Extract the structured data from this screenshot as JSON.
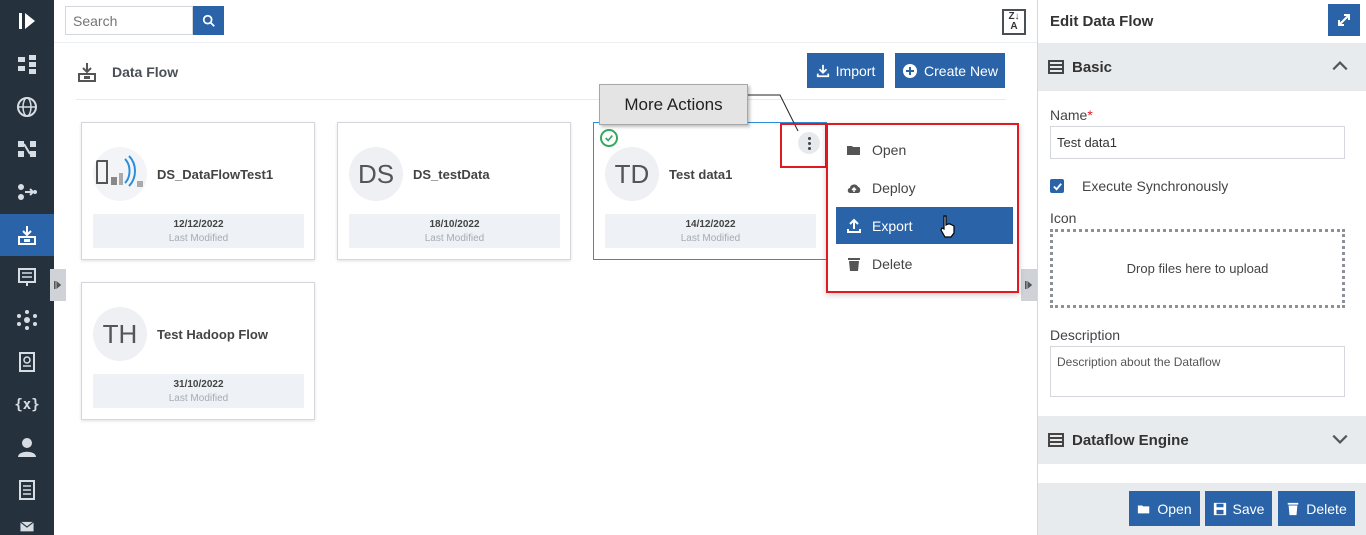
{
  "search": {
    "placeholder": "Search"
  },
  "sort_icon": "sort-za-icon",
  "page": {
    "title": "Data Flow"
  },
  "toolbar": {
    "import_label": "Import",
    "create_label": "Create New"
  },
  "cards": [
    {
      "initials": "",
      "name": "DS_DataFlowTest1",
      "date": "12/12/2022",
      "modified_label": "Last Modified"
    },
    {
      "initials": "DS",
      "name": "DS_testData",
      "date": "18/10/2022",
      "modified_label": "Last Modified"
    },
    {
      "initials": "TD",
      "name": "Test data1",
      "date": "14/12/2022",
      "modified_label": "Last Modified"
    },
    {
      "initials": "TH",
      "name": "Test Hadoop Flow",
      "date": "31/10/2022",
      "modified_label": "Last Modified"
    }
  ],
  "callout": {
    "label": "More Actions"
  },
  "menu": {
    "items": [
      "Open",
      "Deploy",
      "Export",
      "Delete"
    ],
    "active": "Export"
  },
  "panel": {
    "title": "Edit Data Flow",
    "basic_label": "Basic",
    "name_label": "Name",
    "required_mark": "*",
    "name_value": "Test data1",
    "sync_label": "Execute Synchronously",
    "icon_label": "Icon",
    "drop_label": "Drop files here to upload",
    "description_label": "Description",
    "description_placeholder": "Description about the Dataflow",
    "engine_label": "Dataflow Engine",
    "open_label": "Open",
    "save_label": "Save",
    "delete_label": "Delete"
  },
  "colors": {
    "accent": "#2a63a8",
    "rail": "#25313d",
    "highlight": "#e01a22",
    "success": "#36a85e"
  }
}
